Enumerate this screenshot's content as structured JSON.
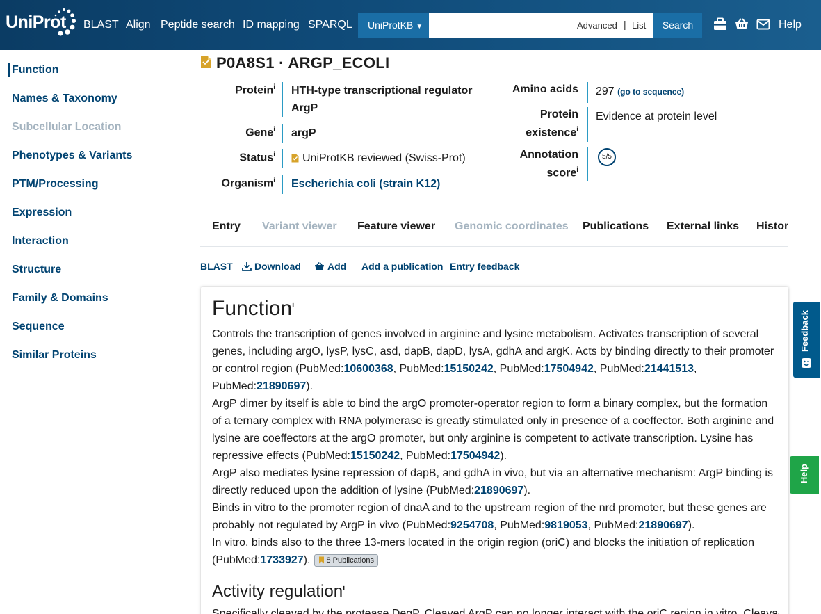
{
  "header": {
    "logo": "UniProt",
    "nav": [
      "BLAST",
      "Align",
      "Peptide search",
      "ID mapping",
      "SPARQL"
    ],
    "search": {
      "database": "UniProtKB",
      "value": "",
      "advanced_label": "Advanced",
      "separator": "|",
      "list_label": "List",
      "button_label": "Search"
    },
    "help_label": "Help",
    "icons": [
      "toolkit-icon",
      "basket-icon",
      "mail-icon"
    ]
  },
  "sidebar": {
    "items": [
      {
        "label": "Function",
        "active": true
      },
      {
        "label": "Names & Taxonomy"
      },
      {
        "label": "Subcellular Location",
        "disabled": true
      },
      {
        "label": "Phenotypes & Variants"
      },
      {
        "label": "PTM/Processing"
      },
      {
        "label": "Expression"
      },
      {
        "label": "Interaction"
      },
      {
        "label": "Structure"
      },
      {
        "label": "Family & Domains"
      },
      {
        "label": "Sequence"
      },
      {
        "label": "Similar Proteins"
      }
    ]
  },
  "entry": {
    "title": "P0A8S1 · ARGP_ECOLI",
    "protein_label": "Protein",
    "protein_value_1": "HTH-type transcriptional regulator",
    "protein_value_2": "ArgP",
    "gene_label": "Gene",
    "gene_value": "argP",
    "status_label": "Status",
    "status_value": "UniProtKB reviewed (Swiss-Prot)",
    "organism_label": "Organism",
    "organism_value": "Escherichia coli (strain K12)",
    "amino_label": "Amino acids",
    "amino_value": "297",
    "amino_link": "(go to sequence)",
    "existence_label_1": "Protein",
    "existence_label_2": "existence",
    "existence_value": "Evidence at protein level",
    "score_label_1": "Annotation",
    "score_label_2": "score",
    "score_value": "5/5",
    "info_mark": "i"
  },
  "tabs": [
    {
      "label": "Entry",
      "enabled": true
    },
    {
      "label": "Variant viewer",
      "enabled": false
    },
    {
      "label": "Feature viewer",
      "enabled": true
    },
    {
      "label": "Genomic coordinates",
      "enabled": false
    },
    {
      "label": "Publications",
      "enabled": true
    },
    {
      "label": "External links",
      "enabled": true
    },
    {
      "label": "Histor",
      "enabled": true
    }
  ],
  "actions": {
    "blast": "BLAST",
    "download": "Download",
    "add": "Add",
    "add_publication": "Add a publication",
    "entry_feedback": "Entry feedback"
  },
  "function_section": {
    "title": "Function",
    "p1": {
      "text1": "Controls the transcription of genes involved in arginine and lysine metabolism. Activates transcription of several genes, including argO, lysP, lysC, asd, dapB, dapD, lysA, gdhA and argK. Acts by binding directly to their promoter or control region (",
      "pubmed_prefix": "PubMed:",
      "refs": [
        "10600368",
        "15150242",
        "17504942",
        "21441513",
        "21890697"
      ],
      "sep": ", ",
      "end": ")."
    },
    "p2": {
      "text1": "ArgP dimer by itself is able to bind the argO promoter-operator region to form a binary complex, but the formation of a ternary complex with RNA polymerase is greatly stimulated only in presence of a coeffector. Both arginine and lysine are coeffectors at the argO promoter, but only arginine is competent to activate transcription. Lysine has repressive effects (",
      "refs": [
        "15150242",
        "17504942"
      ],
      "end": ")."
    },
    "p3": {
      "text1": "ArgP also mediates lysine repression of dapB, and gdhA in vivo, but via an alternative mechanism: ArgP binding is directly reduced upon the addition of lysine (",
      "refs": [
        "21890697"
      ],
      "end": ")."
    },
    "p4": {
      "text1": "Binds in vitro to the promoter region of dnaA and to the upstream region of the nrd promoter, but these genes are probably not regulated by ArgP in vivo (",
      "refs": [
        "9254708",
        "9819053",
        "21890697"
      ],
      "end": ")."
    },
    "p5": {
      "text1": "In vitro, binds also to the three 13-mers located in the origin region (oriC) and blocks the initiation of replication (",
      "refs": [
        "1733927"
      ],
      "end": ")."
    },
    "publications_badge": "8 Publications"
  },
  "activity_section": {
    "title": "Activity regulation",
    "text": "Specifically cleaved by the protease DegP. Cleaved ArgP can no longer interact with the oriC region in vitro. Cleavage"
  },
  "floating": {
    "feedback_label": "Feedback",
    "help_label": "Help"
  },
  "colors": {
    "header_bg": "#0f4a78",
    "link": "#014371",
    "accent_bar": "#2b9bc4",
    "feedback_tab": "#015a8c",
    "help_tab": "#1fa548"
  }
}
